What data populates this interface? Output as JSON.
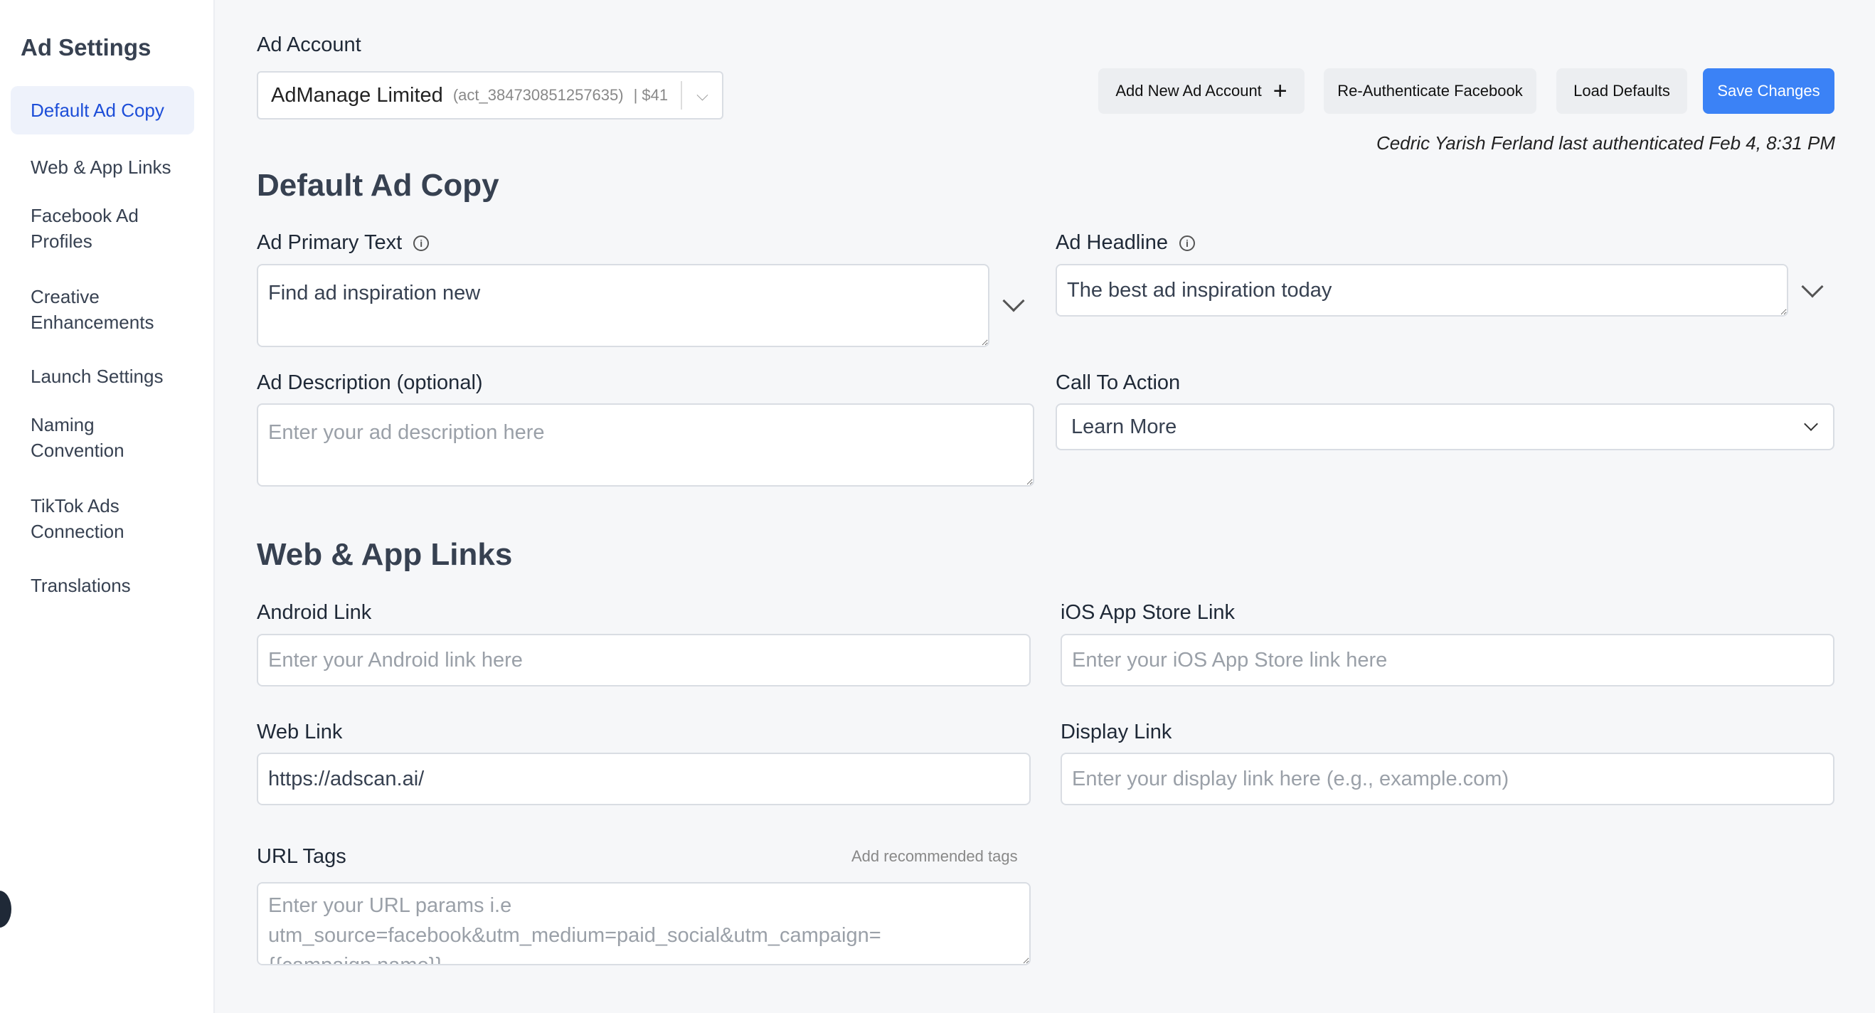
{
  "sidebar": {
    "title": "Ad Settings",
    "items": [
      {
        "label": "Default Ad Copy",
        "active": true
      },
      {
        "label": "Web & App Links"
      },
      {
        "label": "Facebook Ad Profiles"
      },
      {
        "label": "Creative Enhancements"
      },
      {
        "label": "Launch Settings"
      },
      {
        "label": "Naming Convention"
      },
      {
        "label": "TikTok Ads Connection"
      },
      {
        "label": "Translations"
      }
    ]
  },
  "account": {
    "label": "Ad Account",
    "name": "AdManage Limited",
    "id": "(act_384730851257635)",
    "balance": "| $41"
  },
  "toolbar": {
    "add_account": "Add New Ad Account",
    "reauth": "Re-Authenticate Facebook",
    "load_defaults": "Load Defaults",
    "save": "Save Changes"
  },
  "auth_note": "Cedric Yarish Ferland last authenticated Feb 4, 8:31 PM",
  "default_ad_copy": {
    "heading": "Default Ad Copy",
    "primary_text": {
      "label": "Ad Primary Text",
      "value": "Find ad inspiration new"
    },
    "headline": {
      "label": "Ad Headline",
      "value": "The best ad inspiration today"
    },
    "description": {
      "label": "Ad Description (optional)",
      "placeholder": "Enter your ad description here"
    },
    "cta": {
      "label": "Call To Action",
      "value": "Learn More"
    }
  },
  "links": {
    "heading": "Web & App Links",
    "android": {
      "label": "Android Link",
      "placeholder": "Enter your Android link here"
    },
    "ios": {
      "label": "iOS App Store Link",
      "placeholder": "Enter your iOS App Store link here"
    },
    "web": {
      "label": "Web Link",
      "value": "https://adscan.ai/"
    },
    "display": {
      "label": "Display Link",
      "placeholder": "Enter your display link here (e.g., example.com)"
    },
    "url_tags": {
      "label": "URL Tags",
      "add_recommended": "Add recommended tags",
      "placeholder": "Enter your URL params i.e utm_source=facebook&utm_medium=paid_social&utm_campaign={{campaign.name}}"
    }
  },
  "colors": {
    "accent": "#3b82f6",
    "active_nav_bg": "#eef2fb"
  }
}
